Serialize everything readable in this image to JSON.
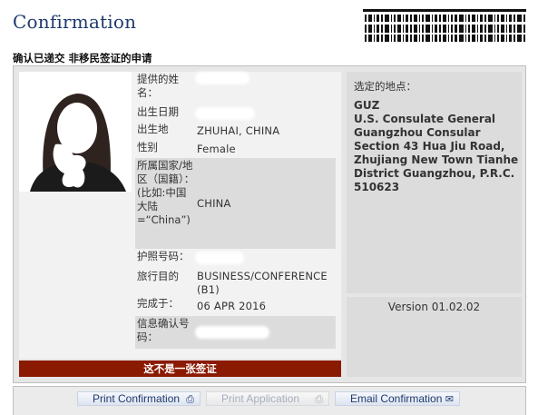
{
  "header": {
    "title": "Confirmation",
    "subtitle": "确认已递交 非移民签证的申请"
  },
  "applicant": {
    "rows": [
      {
        "label": "提供的姓名：",
        "value": ""
      },
      {
        "label": "出生日期",
        "value": ""
      },
      {
        "label": "出生地",
        "value": "ZHUHAI, CHINA"
      },
      {
        "label": "性别",
        "value": "Female"
      },
      {
        "label": "所属国家/地区（国籍）：(比如:中国大陆 =“China”)",
        "value": "CHINA"
      },
      {
        "label": "护照号码：",
        "value": ""
      },
      {
        "label": "旅行目的",
        "value": "BUSINESS/CONFERENCE (B1)"
      },
      {
        "label": "完成于：",
        "value": "06 APR 2016"
      },
      {
        "label": "信息确认号码：",
        "value": ""
      }
    ],
    "notice": "这不是一张签证"
  },
  "location": {
    "label": "选定的地点：",
    "code": "GUZ",
    "address": "U.S. Consulate General Guangzhou Consular Section 43 Hua Jiu Road, Zhujiang New Town Tianhe District Guangzhou, P.R.C. 510623"
  },
  "version": "Version 01.02.02",
  "buttons": {
    "print_confirmation": "Print Confirmation",
    "print_application": "Print Application",
    "email_confirmation": "Email Confirmation"
  },
  "colors": {
    "title": "#1f3a6e",
    "notice_bg": "#8b1a02",
    "panel_bg": "#e6e6e6",
    "alt_row_bg": "#dcdcdc"
  },
  "icons": {
    "print_confirmation": "printer-icon",
    "print_application": "printer-icon",
    "email_confirmation": "envelope-icon"
  }
}
